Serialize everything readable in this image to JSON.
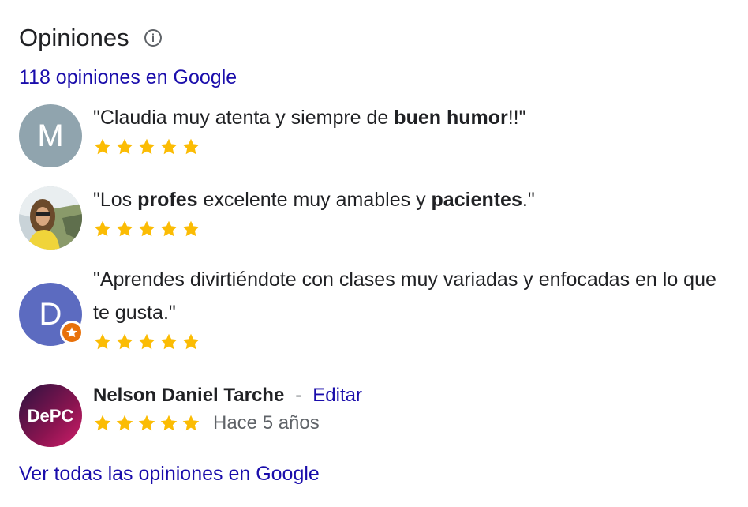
{
  "header": {
    "title": "Opiniones",
    "info_icon": "info-icon"
  },
  "reviews_count_link": "118 opiniones en Google",
  "reviews": [
    {
      "avatar_letter": "M",
      "avatar_color": "#90a4ae",
      "quote_parts": [
        "\"Claudia muy atenta y siempre de ",
        "buen humor",
        "!!\""
      ],
      "rating": 5
    },
    {
      "avatar_letter": "",
      "avatar_type": "photo",
      "quote_parts": [
        "\"Los ",
        "profes",
        " excelente muy amables y ",
        "pacientes",
        ".\""
      ],
      "rating": 5
    },
    {
      "avatar_letter": "D",
      "avatar_color": "#5c6bc0",
      "badge": "local-guide-star-icon",
      "quote_parts": [
        "\"Aprendes divirtiéndote con clases muy variadas y enfocadas en lo que te gusta.\""
      ],
      "rating": 5
    }
  ],
  "own_review": {
    "logo_text": "DePC",
    "name": "Nelson Daniel Tarche",
    "separator": "-",
    "edit_label": "Editar",
    "rating": 5,
    "time": "Hace 5 años"
  },
  "all_reviews_link": "Ver todas las opiniones en Google",
  "colors": {
    "link": "#1a0dab",
    "star": "#fbbc04",
    "text": "#202124",
    "muted": "#5f6368"
  }
}
